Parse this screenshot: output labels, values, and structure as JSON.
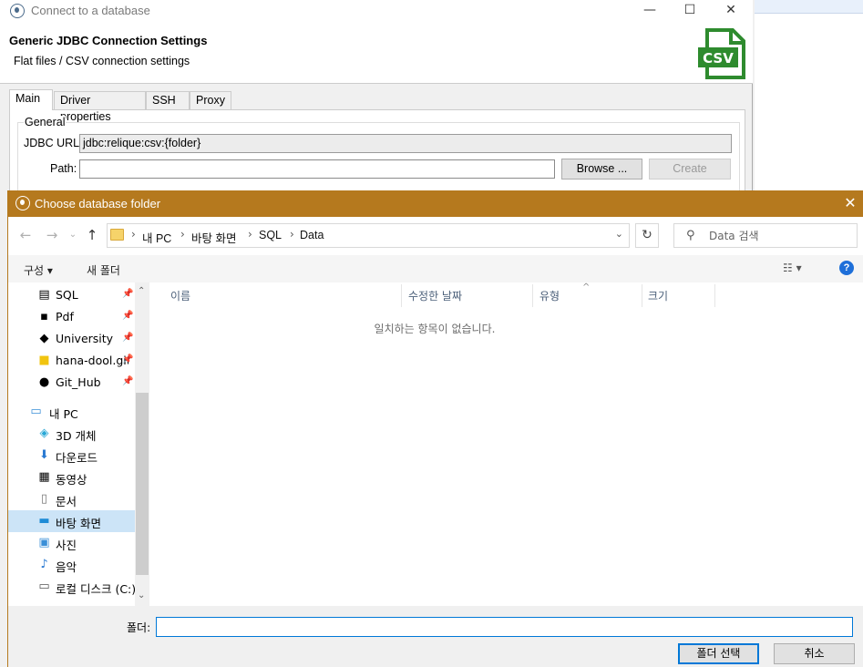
{
  "connect_dialog": {
    "title": "Connect to a database",
    "header_title": "Generic JDBC Connection Settings",
    "header_subtitle": "Flat files / CSV connection settings",
    "logo_text": "CSV",
    "tabs": [
      {
        "label": "Main"
      },
      {
        "label": "Driver properties"
      },
      {
        "label": "SSH"
      },
      {
        "label": "Proxy"
      }
    ],
    "group_label": "General",
    "jdbc_url_label": "JDBC URL:",
    "jdbc_url_value": "jdbc:relique:csv:{folder}",
    "path_label": "Path:",
    "path_value": "",
    "browse_label": "Browse ...",
    "create_label": "Create",
    "window_buttons": {
      "minimize": "—",
      "maximize": "☐",
      "close": "✕"
    }
  },
  "folder_dialog": {
    "title": "Choose database folder",
    "close": "✕",
    "breadcrumbs": [
      "내 PC",
      "바탕 화면",
      "SQL",
      "Data"
    ],
    "search_placeholder": "Data 검색",
    "commands": {
      "organize": "구성 ▾",
      "new_folder": "새 폴더"
    },
    "nav_items": [
      {
        "label": "SQL",
        "icon": "database-icon",
        "pinned": true
      },
      {
        "label": "Pdf",
        "icon": "document-icon",
        "pinned": true
      },
      {
        "label": "University",
        "icon": "graduation-cap-icon",
        "pinned": true
      },
      {
        "label": "hana-dool.github.io",
        "icon": "folder-icon",
        "pinned": true
      },
      {
        "label": "Git_Hub",
        "icon": "github-icon",
        "pinned": true
      },
      {
        "label": "내 PC",
        "icon": "computer-icon"
      },
      {
        "label": "3D 개체",
        "icon": "cube-icon"
      },
      {
        "label": "다운로드",
        "icon": "download-icon"
      },
      {
        "label": "동영상",
        "icon": "video-icon"
      },
      {
        "label": "문서",
        "icon": "documents-icon"
      },
      {
        "label": "바탕 화면",
        "icon": "desktop-icon",
        "selected": true
      },
      {
        "label": "사진",
        "icon": "pictures-icon"
      },
      {
        "label": "음악",
        "icon": "music-icon"
      },
      {
        "label": "로컬 디스크 (C:)",
        "icon": "disk-icon"
      }
    ],
    "columns": [
      "이름",
      "수정한 날짜",
      "유형",
      "크기"
    ],
    "empty_message": "일치하는 항목이 없습니다.",
    "folder_label": "폴더:",
    "folder_value": "",
    "select_button": "폴더 선택",
    "cancel_button": "취소",
    "accent_color": "#b5791e"
  }
}
